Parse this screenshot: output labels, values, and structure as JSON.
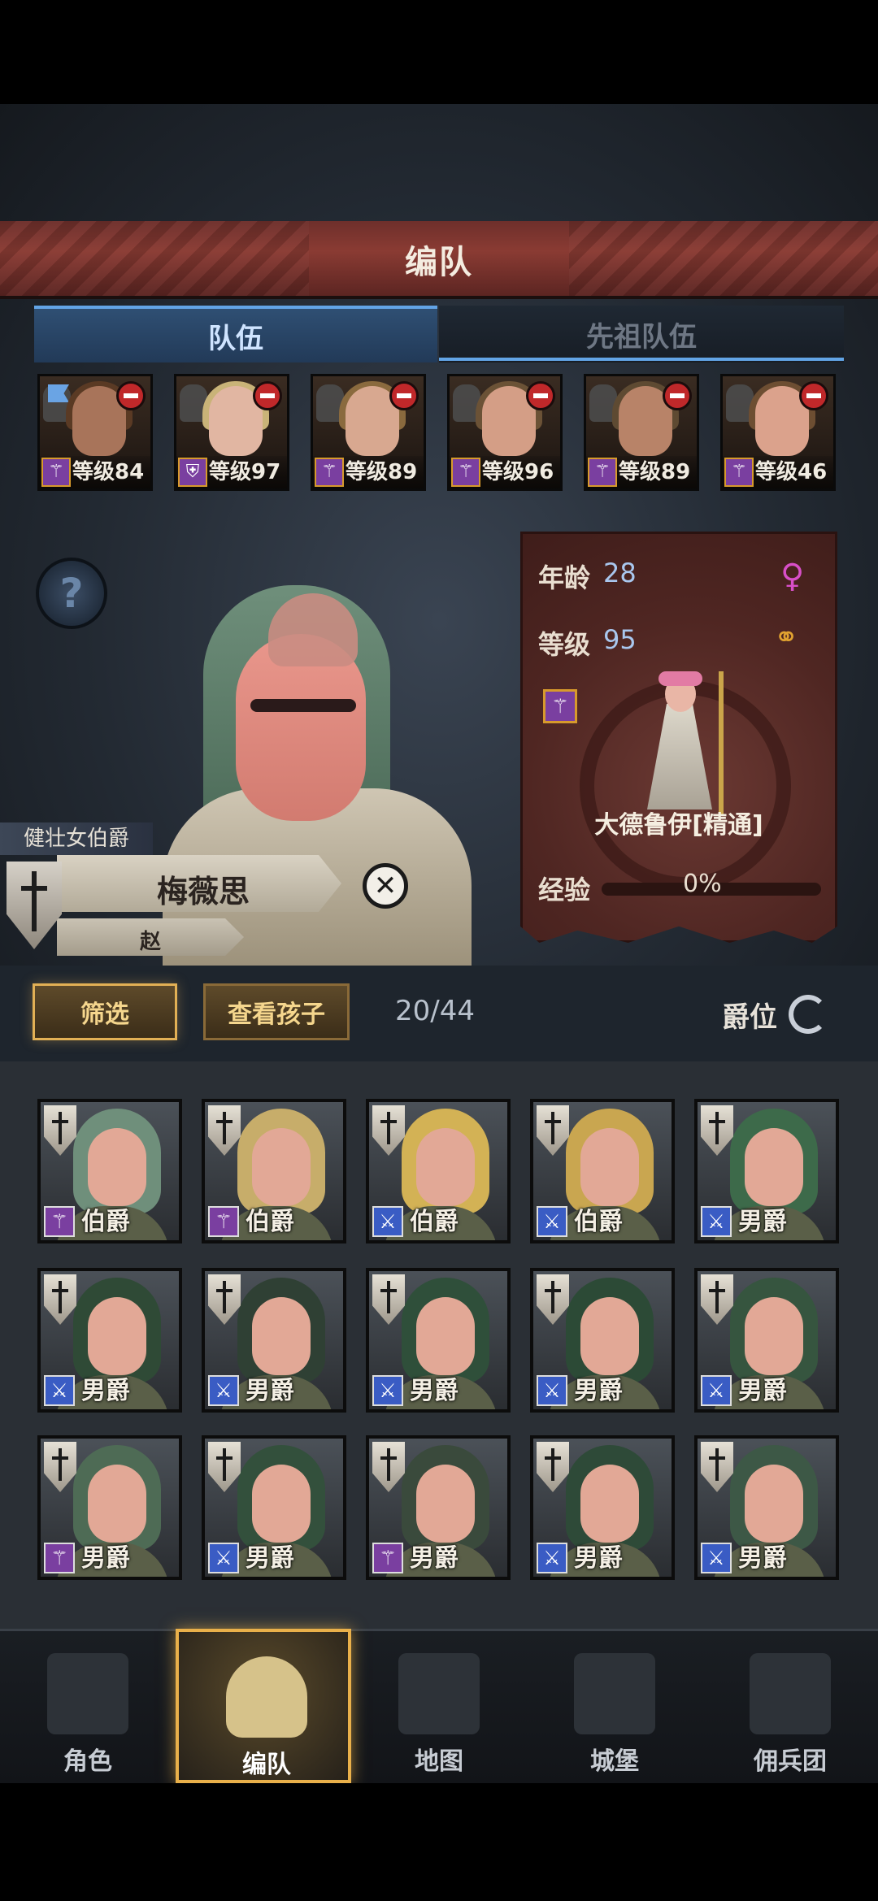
{
  "header": {
    "title": "编队"
  },
  "tabs": [
    {
      "label": "队伍",
      "active": true
    },
    {
      "label": "先祖队伍",
      "active": false
    }
  ],
  "team_slots": [
    {
      "level": "等级84",
      "class_icon": "staff-icon",
      "flag": true,
      "hair": "#5a3a24",
      "face": "#a8745a"
    },
    {
      "level": "等级97",
      "class_icon": "shield-icon",
      "flag": false,
      "hair": "#c9b378",
      "face": "#e1b6a2"
    },
    {
      "level": "等级89",
      "class_icon": "staff-icon",
      "flag": false,
      "hair": "#8a6a3e",
      "face": "#d8a890"
    },
    {
      "level": "等级96",
      "class_icon": "staff-icon",
      "flag": false,
      "hair": "#6b5236",
      "face": "#d49e86"
    },
    {
      "level": "等级89",
      "class_icon": "staff-icon",
      "flag": false,
      "hair": "#5e4a32",
      "face": "#b88368"
    },
    {
      "level": "等级46",
      "class_icon": "staff-icon",
      "flag": false,
      "hair": "#6d4e32",
      "face": "#dba28c"
    }
  ],
  "hero": {
    "noble_title": "健壮女伯爵",
    "name": "梅薇思",
    "surname": "赵",
    "age_label": "年龄",
    "age": "28",
    "level_label": "等级",
    "level": "95",
    "class_name": "大德鲁伊[精通]",
    "exp_label": "经验",
    "exp": "0%"
  },
  "filter": {
    "filter_label": "筛选",
    "children_label": "查看孩子",
    "count": "20/44",
    "sort_label": "爵位"
  },
  "roster": [
    {
      "rank": "伯爵",
      "cls": "purple",
      "hair": "#6f8f7b"
    },
    {
      "rank": "伯爵",
      "cls": "purple",
      "hair": "#c7ad6a"
    },
    {
      "rank": "伯爵",
      "cls": "blue",
      "hair": "#d3b255"
    },
    {
      "rank": "伯爵",
      "cls": "blue",
      "hair": "#c9a650"
    },
    {
      "rank": "男爵",
      "cls": "blue",
      "hair": "#3d6a4a"
    },
    {
      "rank": "男爵",
      "cls": "blue",
      "hair": "#2f4a36"
    },
    {
      "rank": "男爵",
      "cls": "blue",
      "hair": "#2f4034"
    },
    {
      "rank": "男爵",
      "cls": "blue",
      "hair": "#2f4f3a"
    },
    {
      "rank": "男爵",
      "cls": "blue",
      "hair": "#2c4a36"
    },
    {
      "rank": "男爵",
      "cls": "blue",
      "hair": "#36553f"
    },
    {
      "rank": "男爵",
      "cls": "purple",
      "hair": "#4e6b55"
    },
    {
      "rank": "男爵",
      "cls": "blue",
      "hair": "#33503c"
    },
    {
      "rank": "男爵",
      "cls": "purple",
      "hair": "#3a4a3c"
    },
    {
      "rank": "男爵",
      "cls": "blue",
      "hair": "#2e4a38"
    },
    {
      "rank": "男爵",
      "cls": "blue",
      "hair": "#3d5846"
    }
  ],
  "nav": [
    {
      "label": "角色",
      "icon": "knight-icon"
    },
    {
      "label": "编队",
      "icon": "helmet-icon",
      "active": true
    },
    {
      "label": "地图",
      "icon": "compass-icon"
    },
    {
      "label": "城堡",
      "icon": "castle-icon"
    },
    {
      "label": "佣兵团",
      "icon": "banner-icon"
    }
  ],
  "colors": {
    "accent_blue": "#62a4e6",
    "banner_red": "#8a3b33",
    "gold": "#e9b04a",
    "class_purple": "#7a3fa0",
    "class_blue": "#3a5cc4"
  }
}
